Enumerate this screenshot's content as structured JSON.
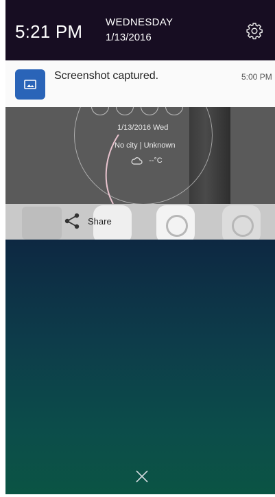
{
  "header": {
    "time": "5:21 PM",
    "day_of_week": "WEDNESDAY",
    "date": "1/13/2016",
    "settings_icon": "gear-icon"
  },
  "notification": {
    "icon": "image-icon",
    "title": "Screenshot captured.",
    "time": "5:00 PM"
  },
  "preview": {
    "date_line": "1/13/2016  Wed",
    "location_line": "No city  |  Unknown",
    "temperature": "--°C"
  },
  "share": {
    "icon": "share-icon",
    "label": "Share"
  },
  "footer": {
    "close_icon": "close-icon"
  },
  "colors": {
    "header_bg": "#170d22",
    "notif_icon_bg": "#2a64b8",
    "gradient_top": "#0d2842",
    "gradient_bottom": "#0b5444"
  }
}
